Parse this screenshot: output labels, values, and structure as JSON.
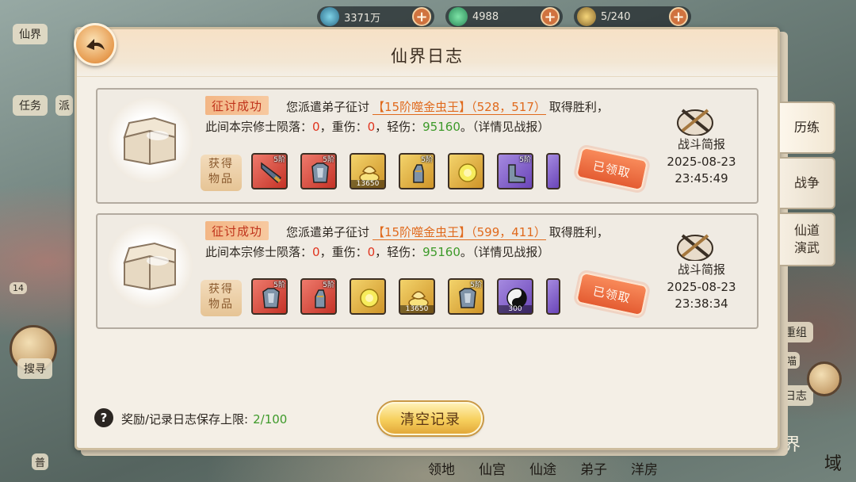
{
  "topbar": {
    "resources": [
      {
        "icon": "spirit-stone-icon",
        "value": "3371万"
      },
      {
        "icon": "jade-icon",
        "value": "4988"
      },
      {
        "icon": "disciple-icon",
        "value": "5/240"
      }
    ]
  },
  "background": {
    "left": {
      "realm_label": "仙界",
      "task_label": "任务",
      "dispatch_label": "派",
      "search_label": "搜寻",
      "badge": "14",
      "bottom_label": "普"
    },
    "right": {
      "regroup_label": "重组",
      "log_label": "日志",
      "cat_label": "喵"
    },
    "bottom_nav": [
      "领地",
      "仙宫",
      "仙途",
      "弟子",
      "洋房"
    ],
    "realm_big": "界",
    "domain_big": "域"
  },
  "panel": {
    "title": "仙界日志",
    "entries": [
      {
        "tag": "征讨成功",
        "text_a": "您派遣弟子征讨",
        "target": "【15阶噬金虫王】（528，517）",
        "text_b": "取得胜利，",
        "casualty_prefix": "此间本宗修士陨落：",
        "deaths": "0",
        "heavy_prefix": "，重伤：",
        "heavy": "0",
        "light_prefix": "，轻伤：",
        "light": "95160",
        "suffix": "。（详情见战报）",
        "obtain_label_1": "获得",
        "obtain_label_2": "物品",
        "items": [
          {
            "icon": "broad-sword-icon",
            "tier": "5阶",
            "count": ""
          },
          {
            "icon": "armor-icon",
            "tier": "5阶",
            "count": ""
          },
          {
            "icon": "gold-coin-pile-icon",
            "tier": "",
            "count": "13650"
          },
          {
            "icon": "gauntlet-icon",
            "tier": "5阶",
            "count": ""
          },
          {
            "icon": "gold-orb-icon",
            "tier": "",
            "count": ""
          },
          {
            "icon": "boots-icon",
            "tier": "5阶",
            "count": ""
          },
          {
            "icon": "partial-item-icon",
            "tier": "",
            "count": ""
          }
        ],
        "claimed": "已领取",
        "report_label": "战斗简报",
        "date": "2025-08-23",
        "time": "23:45:49"
      },
      {
        "tag": "征讨成功",
        "text_a": "您派遣弟子征讨",
        "target": "【15阶噬金虫王】（599，411）",
        "text_b": "取得胜利，",
        "casualty_prefix": "此间本宗修士陨落：",
        "deaths": "0",
        "heavy_prefix": "，重伤：",
        "heavy": "0",
        "light_prefix": "，轻伤：",
        "light": "95160",
        "suffix": "。（详情见战报）",
        "obtain_label_1": "获得",
        "obtain_label_2": "物品",
        "items": [
          {
            "icon": "armor-icon",
            "tier": "5阶",
            "count": ""
          },
          {
            "icon": "gauntlet-icon",
            "tier": "5阶",
            "count": ""
          },
          {
            "icon": "gold-orb-icon",
            "tier": "",
            "count": ""
          },
          {
            "icon": "gold-coin-pile-icon",
            "tier": "",
            "count": "13650"
          },
          {
            "icon": "armor-icon",
            "tier": "5阶",
            "count": ""
          },
          {
            "icon": "yin-yang-icon",
            "tier": "",
            "count": "300"
          },
          {
            "icon": "partial-item-icon",
            "tier": "",
            "count": ""
          }
        ],
        "claimed": "已领取",
        "report_label": "战斗简报",
        "date": "2025-08-23",
        "time": "23:38:34"
      }
    ],
    "footer": {
      "help": "?",
      "limit_label": "奖励/记录日志保存上限:",
      "limit_value": "2/100",
      "clear_button": "清空记录"
    }
  },
  "tabs": [
    {
      "label": "历练",
      "active": true
    },
    {
      "label": "战争",
      "active": false
    },
    {
      "label": "仙道\n演武",
      "active": false
    }
  ],
  "colors": {
    "accent_orange": "#e06a1d",
    "success_tag": "#c0341c",
    "value_red": "#e0341e",
    "value_green": "#3d9a2a",
    "button_gold": "#f6cf5c"
  }
}
